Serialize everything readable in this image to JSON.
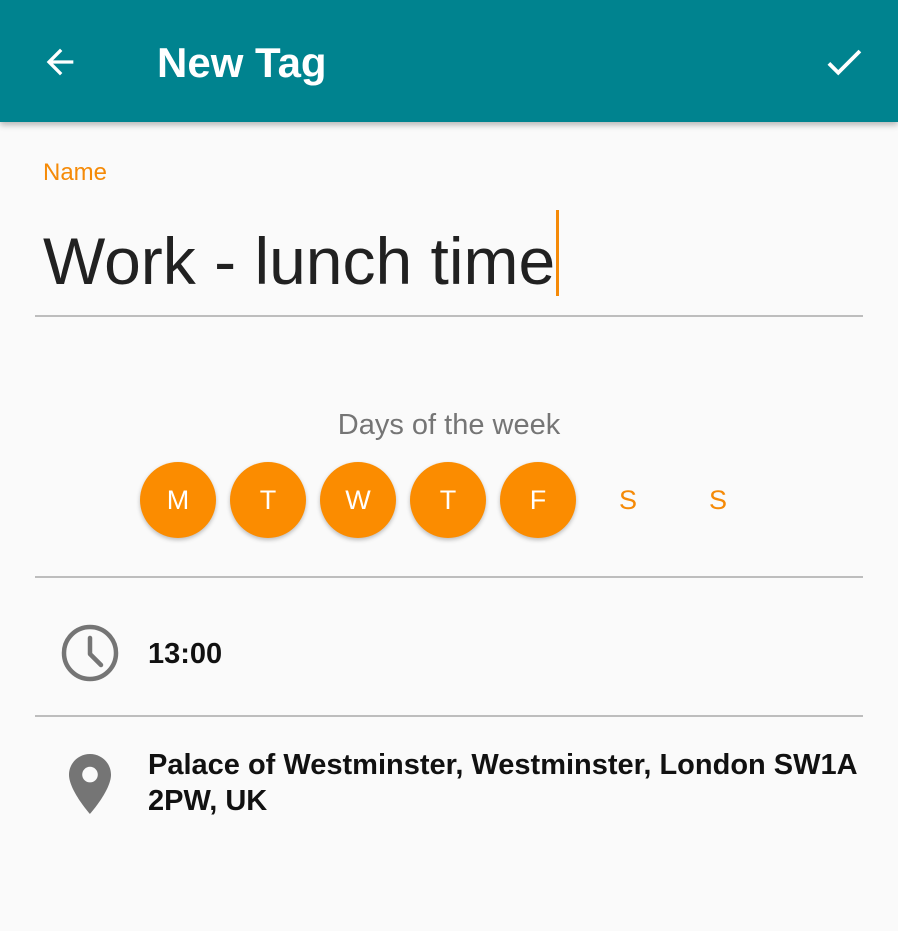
{
  "app_bar": {
    "title": "New Tag",
    "back_icon": "arrow-back-icon",
    "done_icon": "check-icon",
    "background": "#00838f"
  },
  "name_field": {
    "label": "Name",
    "value": "Work - lunch time"
  },
  "days_of_week": {
    "label": "Days of the week",
    "days": [
      {
        "letter": "M",
        "selected": true
      },
      {
        "letter": "T",
        "selected": true
      },
      {
        "letter": "W",
        "selected": true
      },
      {
        "letter": "T",
        "selected": true
      },
      {
        "letter": "F",
        "selected": true
      },
      {
        "letter": "S",
        "selected": false
      },
      {
        "letter": "S",
        "selected": false
      }
    ]
  },
  "time": {
    "icon": "clock-icon",
    "value": "13:00"
  },
  "location": {
    "icon": "location-pin-icon",
    "address": "Palace of Westminster, Westminster, London SW1A 2PW, UK"
  },
  "colors": {
    "accent": "#fb8c00",
    "accent_text": "#f58a07",
    "icon_gray": "#757575"
  }
}
